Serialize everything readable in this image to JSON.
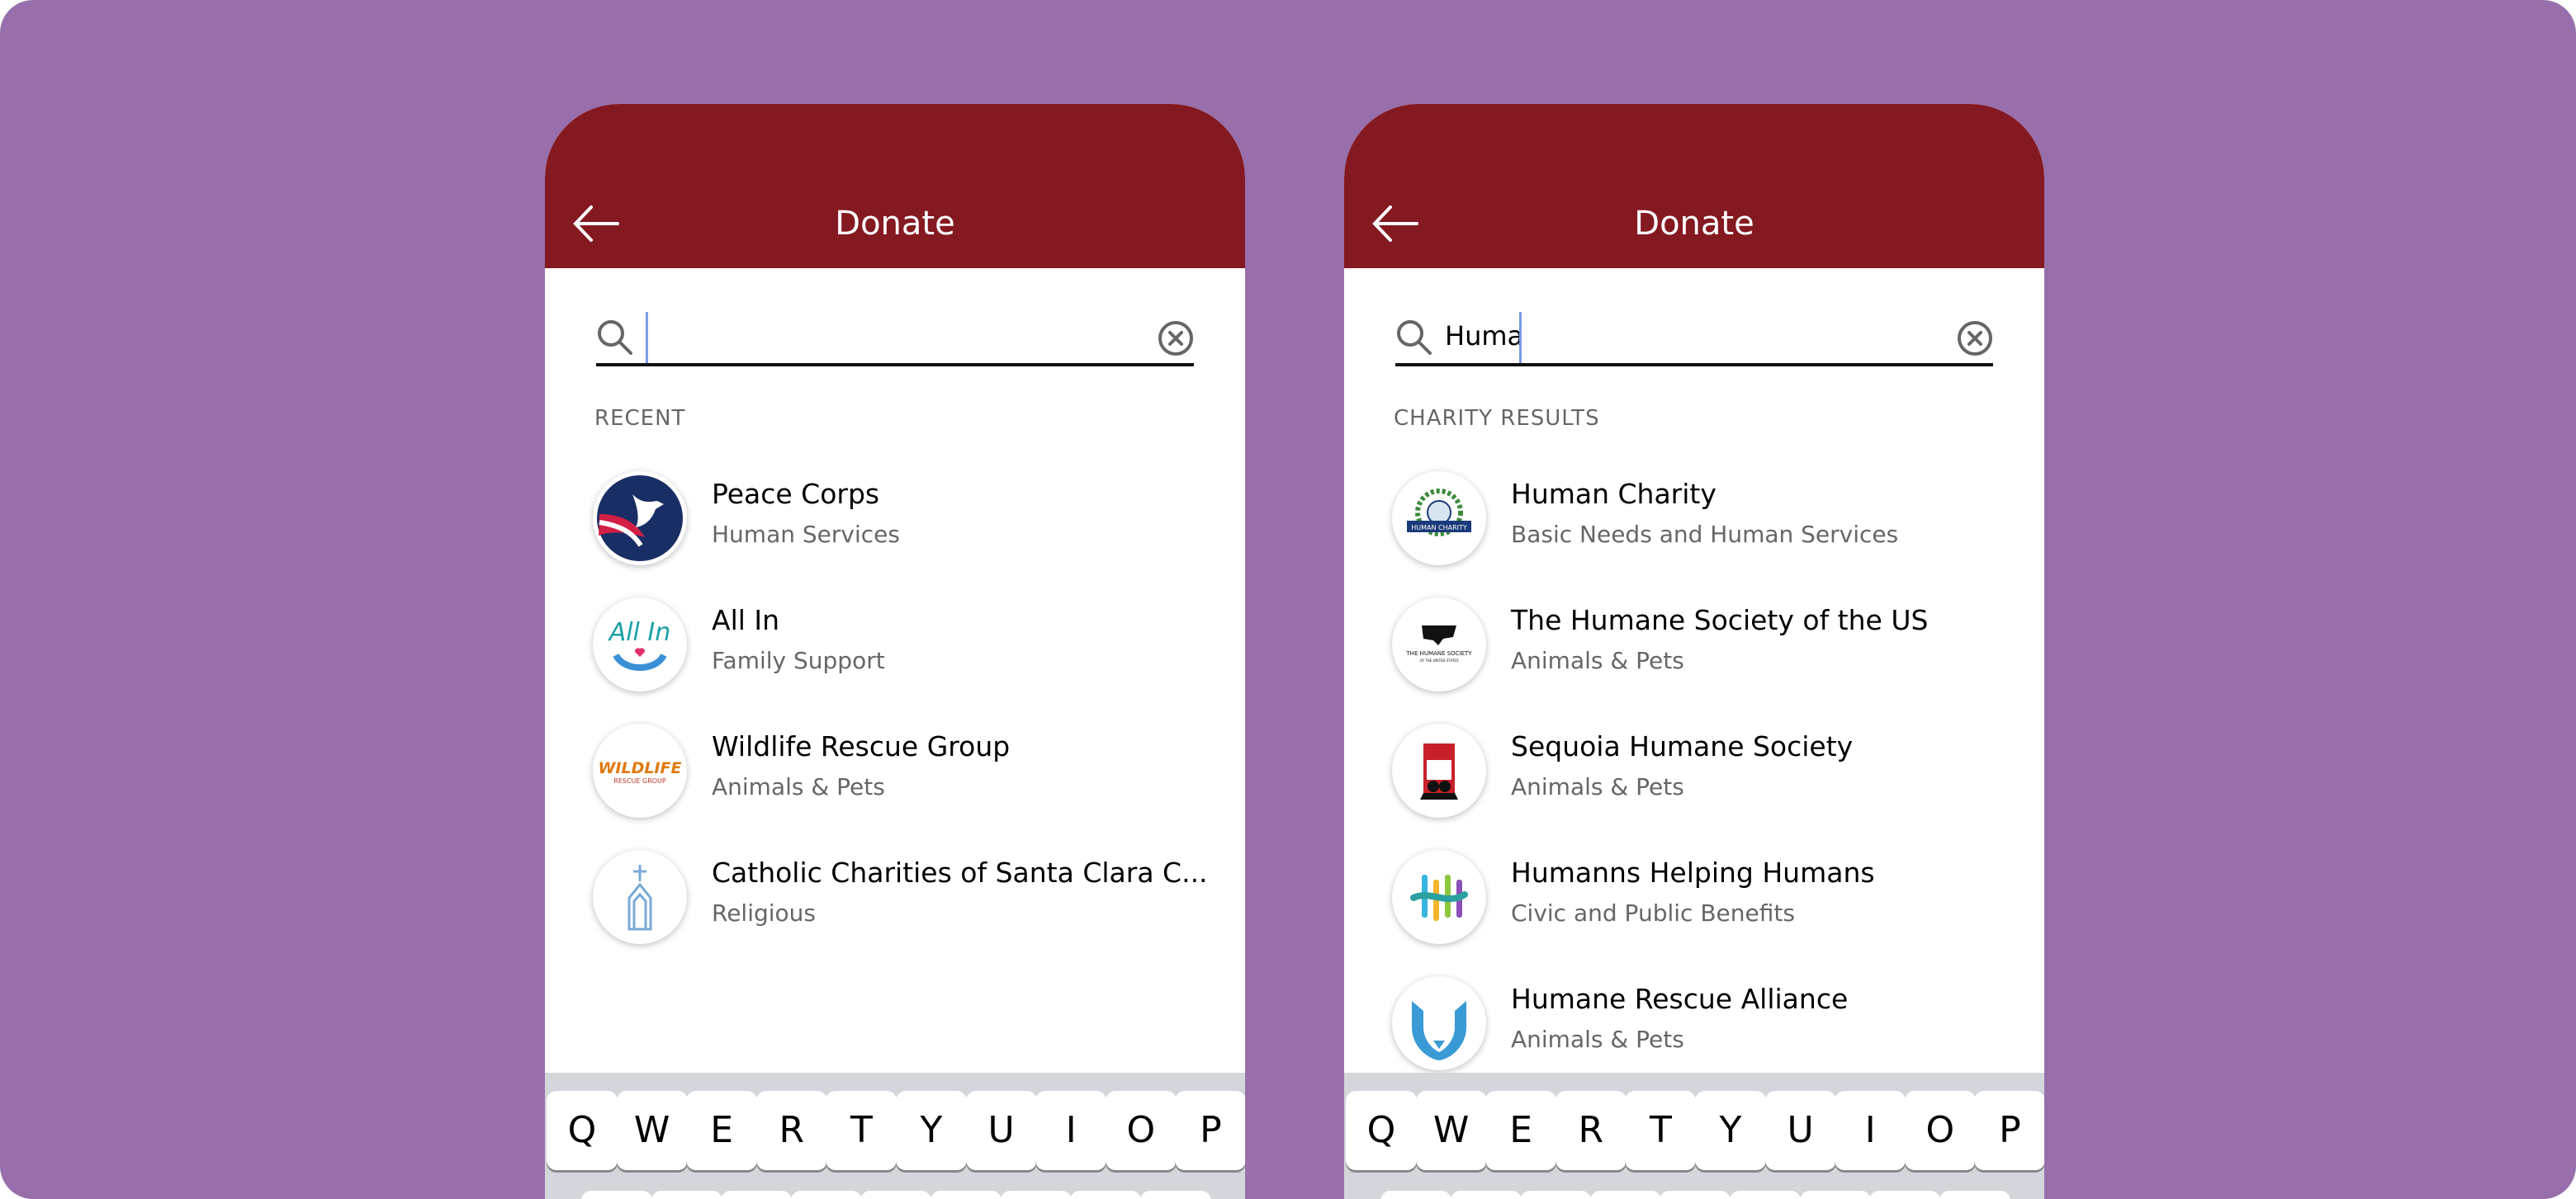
{
  "colors": {
    "background": "#986fab",
    "header": "#841922",
    "caret": "#7b9ce8",
    "keyboard": "#d3d6da"
  },
  "left": {
    "title": "Donate",
    "search_value": "",
    "section": "RECENT",
    "items": [
      {
        "name": "Peace Corps",
        "category": "Human Services",
        "logo": "peace-corps-logo"
      },
      {
        "name": "All In",
        "category": "Family Support",
        "logo": "all-in-logo"
      },
      {
        "name": "Wildlife Rescue Group",
        "category": "Animals & Pets",
        "logo": "wildlife-rescue-logo"
      },
      {
        "name": "Catholic Charities of Santa Clara C...",
        "category": "Religious",
        "logo": "catholic-charities-logo"
      }
    ]
  },
  "right": {
    "title": "Donate",
    "search_value": "Huma",
    "section": "CHARITY RESULTS",
    "items": [
      {
        "name": "Human Charity",
        "category": "Basic Needs and Human Services",
        "logo": "human-charity-logo"
      },
      {
        "name": "The Humane Society of the US",
        "category": "Animals & Pets",
        "logo": "humane-society-logo"
      },
      {
        "name": "Sequoia Humane Society",
        "category": "Animals & Pets",
        "logo": "sequoia-humane-logo"
      },
      {
        "name": "Humanns Helping Humans",
        "category": "Civic and Public Benefits",
        "logo": "humanns-helping-logo"
      },
      {
        "name": "Humane Rescue Alliance",
        "category": "Animals & Pets",
        "logo": "humane-rescue-logo"
      }
    ]
  },
  "keyboard": {
    "row1": [
      "Q",
      "W",
      "E",
      "R",
      "T",
      "Y",
      "U",
      "I",
      "O",
      "P"
    ]
  }
}
